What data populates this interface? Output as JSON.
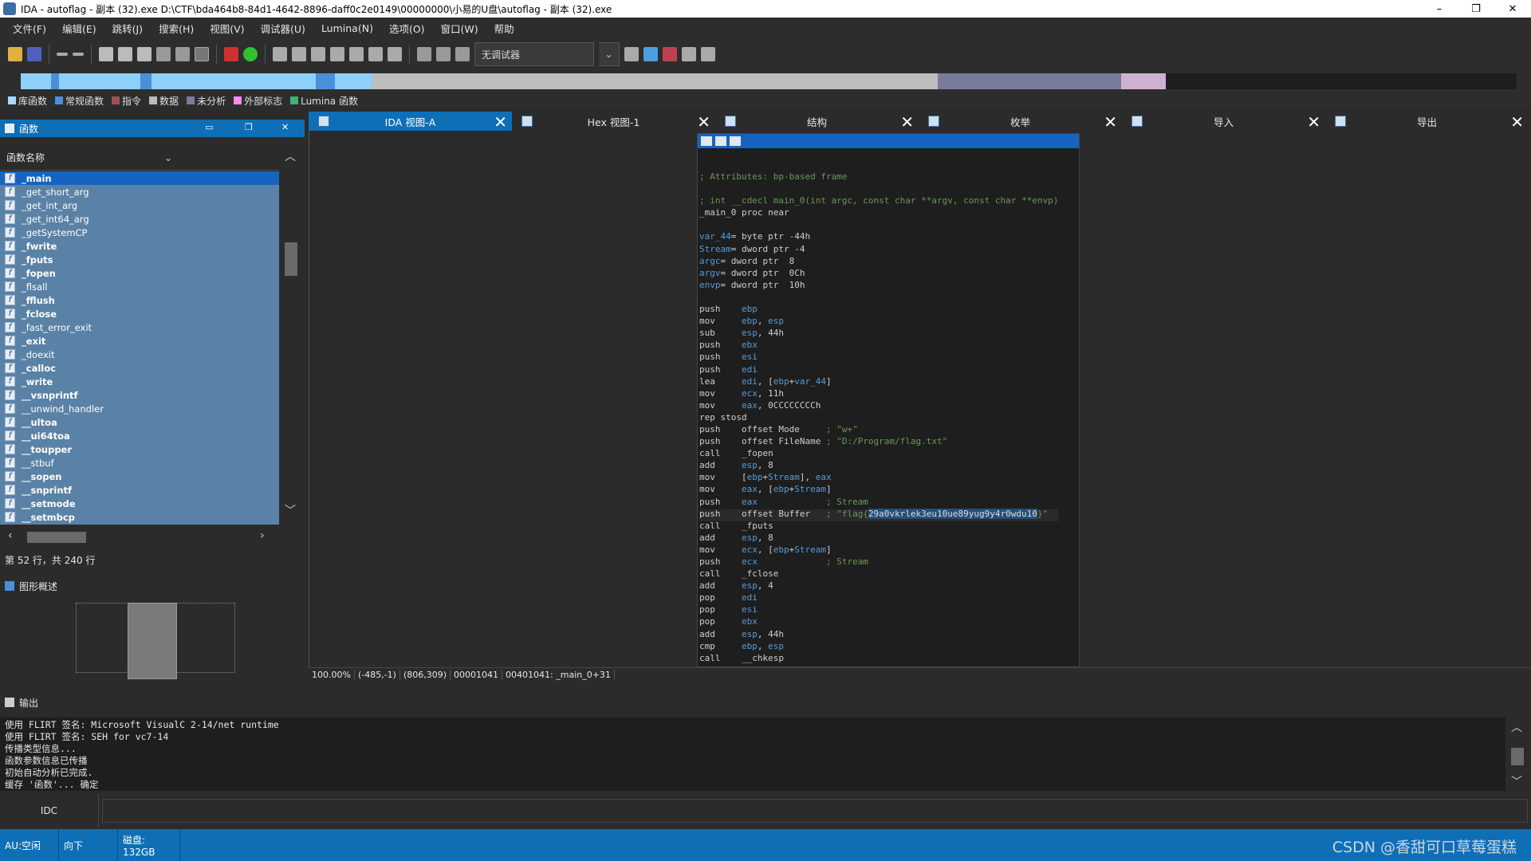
{
  "window": {
    "title": "IDA - autoflag - 副本 (32).exe D:\\CTF\\bda464b8-84d1-4642-8896-daff0c2e0149\\00000000\\小易的U盘\\autoflag - 副本 (32).exe",
    "minimize": "–",
    "maximize": "❐",
    "close": "✕"
  },
  "menu": [
    "文件(F)",
    "编辑(E)",
    "跳转(J)",
    "搜索(H)",
    "视图(V)",
    "调试器(U)",
    "Lumina(N)",
    "选项(O)",
    "窗口(W)",
    "帮助"
  ],
  "toolbar": {
    "debugger_select": "无调试器"
  },
  "legend": [
    {
      "label": "库函数",
      "color": "#a8d8ff"
    },
    {
      "label": "常规函数",
      "color": "#4a90d9"
    },
    {
      "label": "指令",
      "color": "#a05050"
    },
    {
      "label": "数据",
      "color": "#bbbbbb"
    },
    {
      "label": "未分析",
      "color": "#7a7a9a"
    },
    {
      "label": "外部标志",
      "color": "#ff88ff"
    },
    {
      "label": "Lumina 函数",
      "color": "#3cb371"
    }
  ],
  "functions": {
    "title": "函数",
    "column": "函数名称",
    "items": [
      {
        "name": "_main",
        "bold": true
      },
      {
        "name": "_get_short_arg",
        "bold": false
      },
      {
        "name": "_get_int_arg",
        "bold": false
      },
      {
        "name": "_get_int64_arg",
        "bold": false
      },
      {
        "name": "_getSystemCP",
        "bold": false
      },
      {
        "name": "_fwrite",
        "bold": true
      },
      {
        "name": "_fputs",
        "bold": true
      },
      {
        "name": "_fopen",
        "bold": true
      },
      {
        "name": "_flsall",
        "bold": false
      },
      {
        "name": "_fflush",
        "bold": true
      },
      {
        "name": "_fclose",
        "bold": true
      },
      {
        "name": "_fast_error_exit",
        "bold": false
      },
      {
        "name": "_exit",
        "bold": true
      },
      {
        "name": "_doexit",
        "bold": false
      },
      {
        "name": "_calloc",
        "bold": true
      },
      {
        "name": "_write",
        "bold": true
      },
      {
        "name": "__vsnprintf",
        "bold": true
      },
      {
        "name": "__unwind_handler",
        "bold": false
      },
      {
        "name": "__ultoa",
        "bold": true
      },
      {
        "name": "__ui64toa",
        "bold": true
      },
      {
        "name": "__toupper",
        "bold": true
      },
      {
        "name": "__stbuf",
        "bold": false
      },
      {
        "name": "__sopen",
        "bold": true
      },
      {
        "name": "__snprintf",
        "bold": true
      },
      {
        "name": "__setmode",
        "bold": true
      },
      {
        "name": "__setmbcp",
        "bold": true
      }
    ],
    "status": "第 52 行，共 240 行"
  },
  "graph_overview": {
    "title": "图形概述"
  },
  "tabs": [
    {
      "label": "IDA 视图-A",
      "active": true
    },
    {
      "label": "Hex 视图-1",
      "active": false
    },
    {
      "label": "结构",
      "active": false
    },
    {
      "label": "枚举",
      "active": false
    },
    {
      "label": "导入",
      "active": false
    },
    {
      "label": "导出",
      "active": false
    }
  ],
  "disasm": {
    "lines": [
      [
        [
          "cmt",
          "; Attributes: bp-based frame"
        ]
      ],
      [
        [
          "",
          ""
        ]
      ],
      [
        [
          "cmt",
          "; int __cdecl main_0(int argc, const char **argv, const char **envp)"
        ]
      ],
      [
        [
          "lab",
          "_main_0 proc near"
        ]
      ],
      [
        [
          "",
          ""
        ]
      ],
      [
        [
          "reg",
          "var_44"
        ],
        [
          "lab",
          "= byte ptr -44h"
        ]
      ],
      [
        [
          "reg",
          "Stream"
        ],
        [
          "lab",
          "= dword ptr -4"
        ]
      ],
      [
        [
          "reg",
          "argc"
        ],
        [
          "lab",
          "= dword ptr  8"
        ]
      ],
      [
        [
          "reg",
          "argv"
        ],
        [
          "lab",
          "= dword ptr  0Ch"
        ]
      ],
      [
        [
          "reg",
          "envp"
        ],
        [
          "lab",
          "= dword ptr  10h"
        ]
      ],
      [
        [
          "",
          ""
        ]
      ],
      [
        [
          "kw",
          "push    "
        ],
        [
          "reg",
          "ebp"
        ]
      ],
      [
        [
          "kw",
          "mov     "
        ],
        [
          "reg",
          "ebp"
        ],
        [
          "kw",
          ", "
        ],
        [
          "reg",
          "esp"
        ]
      ],
      [
        [
          "kw",
          "sub     "
        ],
        [
          "reg",
          "esp"
        ],
        [
          "kw",
          ", 44h"
        ]
      ],
      [
        [
          "kw",
          "push    "
        ],
        [
          "reg",
          "ebx"
        ]
      ],
      [
        [
          "kw",
          "push    "
        ],
        [
          "reg",
          "esi"
        ]
      ],
      [
        [
          "kw",
          "push    "
        ],
        [
          "reg",
          "edi"
        ]
      ],
      [
        [
          "kw",
          "lea     "
        ],
        [
          "reg",
          "edi"
        ],
        [
          "kw",
          ", ["
        ],
        [
          "reg",
          "ebp"
        ],
        [
          "kw",
          "+"
        ],
        [
          "reg",
          "var_44"
        ],
        [
          "kw",
          "]"
        ]
      ],
      [
        [
          "kw",
          "mov     "
        ],
        [
          "reg",
          "ecx"
        ],
        [
          "kw",
          ", 11h"
        ]
      ],
      [
        [
          "kw",
          "mov     "
        ],
        [
          "reg",
          "eax"
        ],
        [
          "kw",
          ", 0CCCCCCCCh"
        ]
      ],
      [
        [
          "kw",
          "rep stosd"
        ]
      ],
      [
        [
          "kw",
          "push    offset Mode     "
        ],
        [
          "cmt",
          "; \"w+\""
        ]
      ],
      [
        [
          "kw",
          "push    offset FileName "
        ],
        [
          "cmt",
          "; \"D:/Program/flag.txt\""
        ]
      ],
      [
        [
          "kw",
          "call    _fopen"
        ]
      ],
      [
        [
          "kw",
          "add     "
        ],
        [
          "reg",
          "esp"
        ],
        [
          "kw",
          ", 8"
        ]
      ],
      [
        [
          "kw",
          "mov     ["
        ],
        [
          "reg",
          "ebp"
        ],
        [
          "kw",
          "+"
        ],
        [
          "reg",
          "Stream"
        ],
        [
          "kw",
          "], "
        ],
        [
          "reg",
          "eax"
        ]
      ],
      [
        [
          "kw",
          "mov     "
        ],
        [
          "reg",
          "eax"
        ],
        [
          "kw",
          ", ["
        ],
        [
          "reg",
          "ebp"
        ],
        [
          "kw",
          "+"
        ],
        [
          "reg",
          "Stream"
        ],
        [
          "kw",
          "]"
        ]
      ],
      [
        [
          "kw",
          "push    "
        ],
        [
          "reg",
          "eax"
        ],
        [
          "cmt",
          "             ; Stream"
        ]
      ],
      [
        [
          "kw",
          "push    offset Buffer   "
        ],
        [
          "cmt",
          "; \"flag{"
        ],
        [
          "hl",
          "29a0vkrlek3eu10ue89yug9y4r0wdu10"
        ],
        [
          "cmt",
          "}\""
        ]
      ],
      [
        [
          "kw",
          "call    _fputs"
        ]
      ],
      [
        [
          "kw",
          "add     "
        ],
        [
          "reg",
          "esp"
        ],
        [
          "kw",
          ", 8"
        ]
      ],
      [
        [
          "kw",
          "mov     "
        ],
        [
          "reg",
          "ecx"
        ],
        [
          "kw",
          ", ["
        ],
        [
          "reg",
          "ebp"
        ],
        [
          "kw",
          "+"
        ],
        [
          "reg",
          "Stream"
        ],
        [
          "kw",
          "]"
        ]
      ],
      [
        [
          "kw",
          "push    "
        ],
        [
          "reg",
          "ecx"
        ],
        [
          "cmt",
          "             ; Stream"
        ]
      ],
      [
        [
          "kw",
          "call    _fclose"
        ]
      ],
      [
        [
          "kw",
          "add     "
        ],
        [
          "reg",
          "esp"
        ],
        [
          "kw",
          ", 4"
        ]
      ],
      [
        [
          "kw",
          "pop     "
        ],
        [
          "reg",
          "edi"
        ]
      ],
      [
        [
          "kw",
          "pop     "
        ],
        [
          "reg",
          "esi"
        ]
      ],
      [
        [
          "kw",
          "pop     "
        ],
        [
          "reg",
          "ebx"
        ]
      ],
      [
        [
          "kw",
          "add     "
        ],
        [
          "reg",
          "esp"
        ],
        [
          "kw",
          ", 44h"
        ]
      ],
      [
        [
          "kw",
          "cmp     "
        ],
        [
          "reg",
          "ebp"
        ],
        [
          "kw",
          ", "
        ],
        [
          "reg",
          "esp"
        ]
      ],
      [
        [
          "kw",
          "call    __chkesp"
        ]
      ]
    ],
    "status": [
      "100.00%",
      "(-485,-1)",
      "(806,309)",
      "00001041",
      "00401041: _main_0+31"
    ]
  },
  "output": {
    "title": "输出",
    "lines": [
      "使用 FLIRT 签名: Microsoft VisualC 2-14/net runtime",
      "使用 FLIRT 签名: SEH for vc7-14",
      "传播类型信息...",
      "函数参数信息已传播",
      "初始自动分析已完成.",
      "缓存 '函数'... 确定"
    ],
    "idc_label": "IDC"
  },
  "statusbar": {
    "au": "AU:空闲",
    "dir": "向下",
    "disk": "磁盘: 132GB",
    "watermark": "CSDN @香甜可口草莓蛋糕"
  }
}
